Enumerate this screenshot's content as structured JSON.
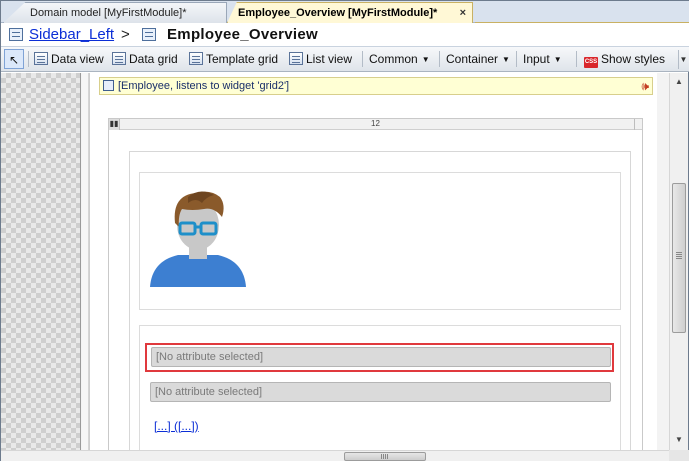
{
  "tabs": [
    {
      "label": "Domain model [MyFirstModule]*",
      "active": false
    },
    {
      "label": "Employee_Overview [MyFirstModule]*",
      "active": true
    }
  ],
  "tab_close": "×",
  "breadcrumb": {
    "layout_link": "Sidebar_Left",
    "separator": ">",
    "page_title": "Employee_Overview"
  },
  "toolbar": {
    "pointer": "↖",
    "data_view": "Data view",
    "data_grid": "Data grid",
    "template_grid": "Template grid",
    "list_view": "List view",
    "common": "Common",
    "container": "Container",
    "input": "Input",
    "show_styles": "Show styles",
    "css_badge": "CSS",
    "dropdown_caret": "▼",
    "more": "▼"
  },
  "data_view": {
    "header": "[Employee, listens to widget 'grid2']",
    "listen_icon": "🕪"
  },
  "layout_grid": {
    "column_width": "12",
    "handle": "▮▮"
  },
  "fields": [
    {
      "placeholder": "[No attribute selected]",
      "highlighted": true
    },
    {
      "placeholder": "[No attribute selected]",
      "highlighted": false
    }
  ],
  "reference_link": "[...] ([...])",
  "scrollbar": {
    "up": "▲",
    "down": "▼"
  },
  "colors": {
    "highlight": "#e0393d",
    "link": "#0b2ed6",
    "avatar_hair": "#8a5a2b",
    "avatar_skin": "#c8c8c8",
    "avatar_shirt": "#3d7fd1",
    "avatar_glasses": "#1e8fc9"
  }
}
